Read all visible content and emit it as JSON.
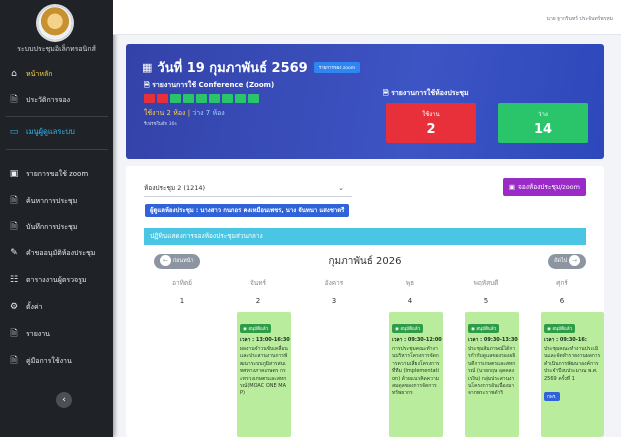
{
  "sidebar": {
    "system_title": "ระบบประชุมอิเล็กทรอนิกส์",
    "items": [
      {
        "label": "หน้าหลัก",
        "icon": "home-icon"
      },
      {
        "label": "ประวัติการจอง",
        "icon": "document-icon"
      },
      {
        "label": "เมนูผู้ดูแลระบบ",
        "icon": "computer-icon"
      },
      {
        "label": "รายการขอใช้ zoom",
        "icon": "monitor-icon"
      },
      {
        "label": "ค้นหาการประชุม",
        "icon": "search-document-icon"
      },
      {
        "label": "บันทึกการประชุม",
        "icon": "notes-icon"
      },
      {
        "label": "คำขออนุมัติห้องประชุม",
        "icon": "pencil-icon"
      },
      {
        "label": "ตารางงานผู้ตรวจรูม",
        "icon": "table-icon"
      },
      {
        "label": "ตั้งค่า",
        "icon": "gear-icon"
      },
      {
        "label": "รายงาน",
        "icon": "report-icon"
      },
      {
        "label": "คู่มือการใช้งาน",
        "icon": "manual-icon"
      }
    ],
    "collapse_icon": "chevron-left-icon"
  },
  "topbar": {
    "user_text": "นาย ฐากรินทร์ ประจันทร์พรหม"
  },
  "banner": {
    "date_title": "วันที่ 19 กุมภาพันธ์ 2569",
    "pill_label": "รายการจอง zoom",
    "conference_title": "รายงานการใช้ Conference (Zoom)",
    "rooms_title": "รายงานการใช้ห้องประชุม",
    "usage_used": "ใช้งาน 2 ห้อง",
    "usage_free": "ว่าง 7 ห้อง",
    "usage_note": "รีเฟรชในอีก 30s",
    "room_states": [
      "busy",
      "busy",
      "free",
      "free",
      "free",
      "free",
      "free",
      "free",
      "free"
    ],
    "busy_color": "#e8303a",
    "free_color": "#2ac46b",
    "stat_used": {
      "label": "ใช้งาน",
      "value": "2"
    },
    "stat_free": {
      "label": "ว่าง",
      "value": "14"
    }
  },
  "main": {
    "room_select": "ห้องประชุม 2 (1214)",
    "book_button": "จองห้องประชุม/zoom",
    "owner_label": "ผู้ดูแลห้องประชุม : นางสาว กนกอร คงเหมือนเพชร, นาง จันทนา แสงชาตรี",
    "calendar_header": "ปฏิทินแสดงการจองห้องประชุมส่วนกลาง",
    "prev_label": "ก่อนหน้า",
    "next_label": "ถัดไป",
    "month_title": "กุมภาพันธ์ 2026",
    "weekdays": [
      "อาทิตย์",
      "จันทร์",
      "อังคาร",
      "พุธ",
      "พฤหัสบดี",
      "ศุกร์"
    ],
    "days": [
      "1",
      "2",
      "3",
      "4",
      "5",
      "6"
    ],
    "events": [
      {
        "badge": "อนุมัติแล้ว",
        "time": "เวลา : 13:00-16:30",
        "text": "ผลงานจำวนขับเคลื่อนและประสานงานการพัฒนาระบบภูมิสารสนเทศทางภาคเกษตร กระทรวงเกษตรและสหกรณ์(MOAC ONE MAP)"
      },
      {
        "badge": "อนุมัติแล้ว",
        "time": "เวลา : 09:30-12:00",
        "text": "การประชุมคณะทำงานบริหารโครงการจัดการความเสี่ยงโครงการที่ทีม (Implementation) ด้วยแนวคิดความสมดุลของการจัดการทรัพยากร"
      },
      {
        "badge": "อนุมัติแล้ว",
        "time": "เวลา : 09:30-13:30",
        "text": "ประชุมสัมภาษณ์ได้การกำกับดูแลของรองอธิบดีการเกษตรและสหกรณ์ (นายกฤษ อุดคลง เรงิน) กลุ่มประสานงานโครงการอันเนื่องมาจากพระราชดำริ"
      },
      {
        "badge": "อนุมัติแล้ว",
        "time": "เวลา : 09:30-16:",
        "text": "ประชุมคณะทำงานประเมินและจัดทำรายงานผลการดำเนินการพัฒนาองค์การ ประจำปีงบประมาณ พ.ศ. 2569 ครั้งที่ 1",
        "tag": "กพร."
      }
    ]
  }
}
